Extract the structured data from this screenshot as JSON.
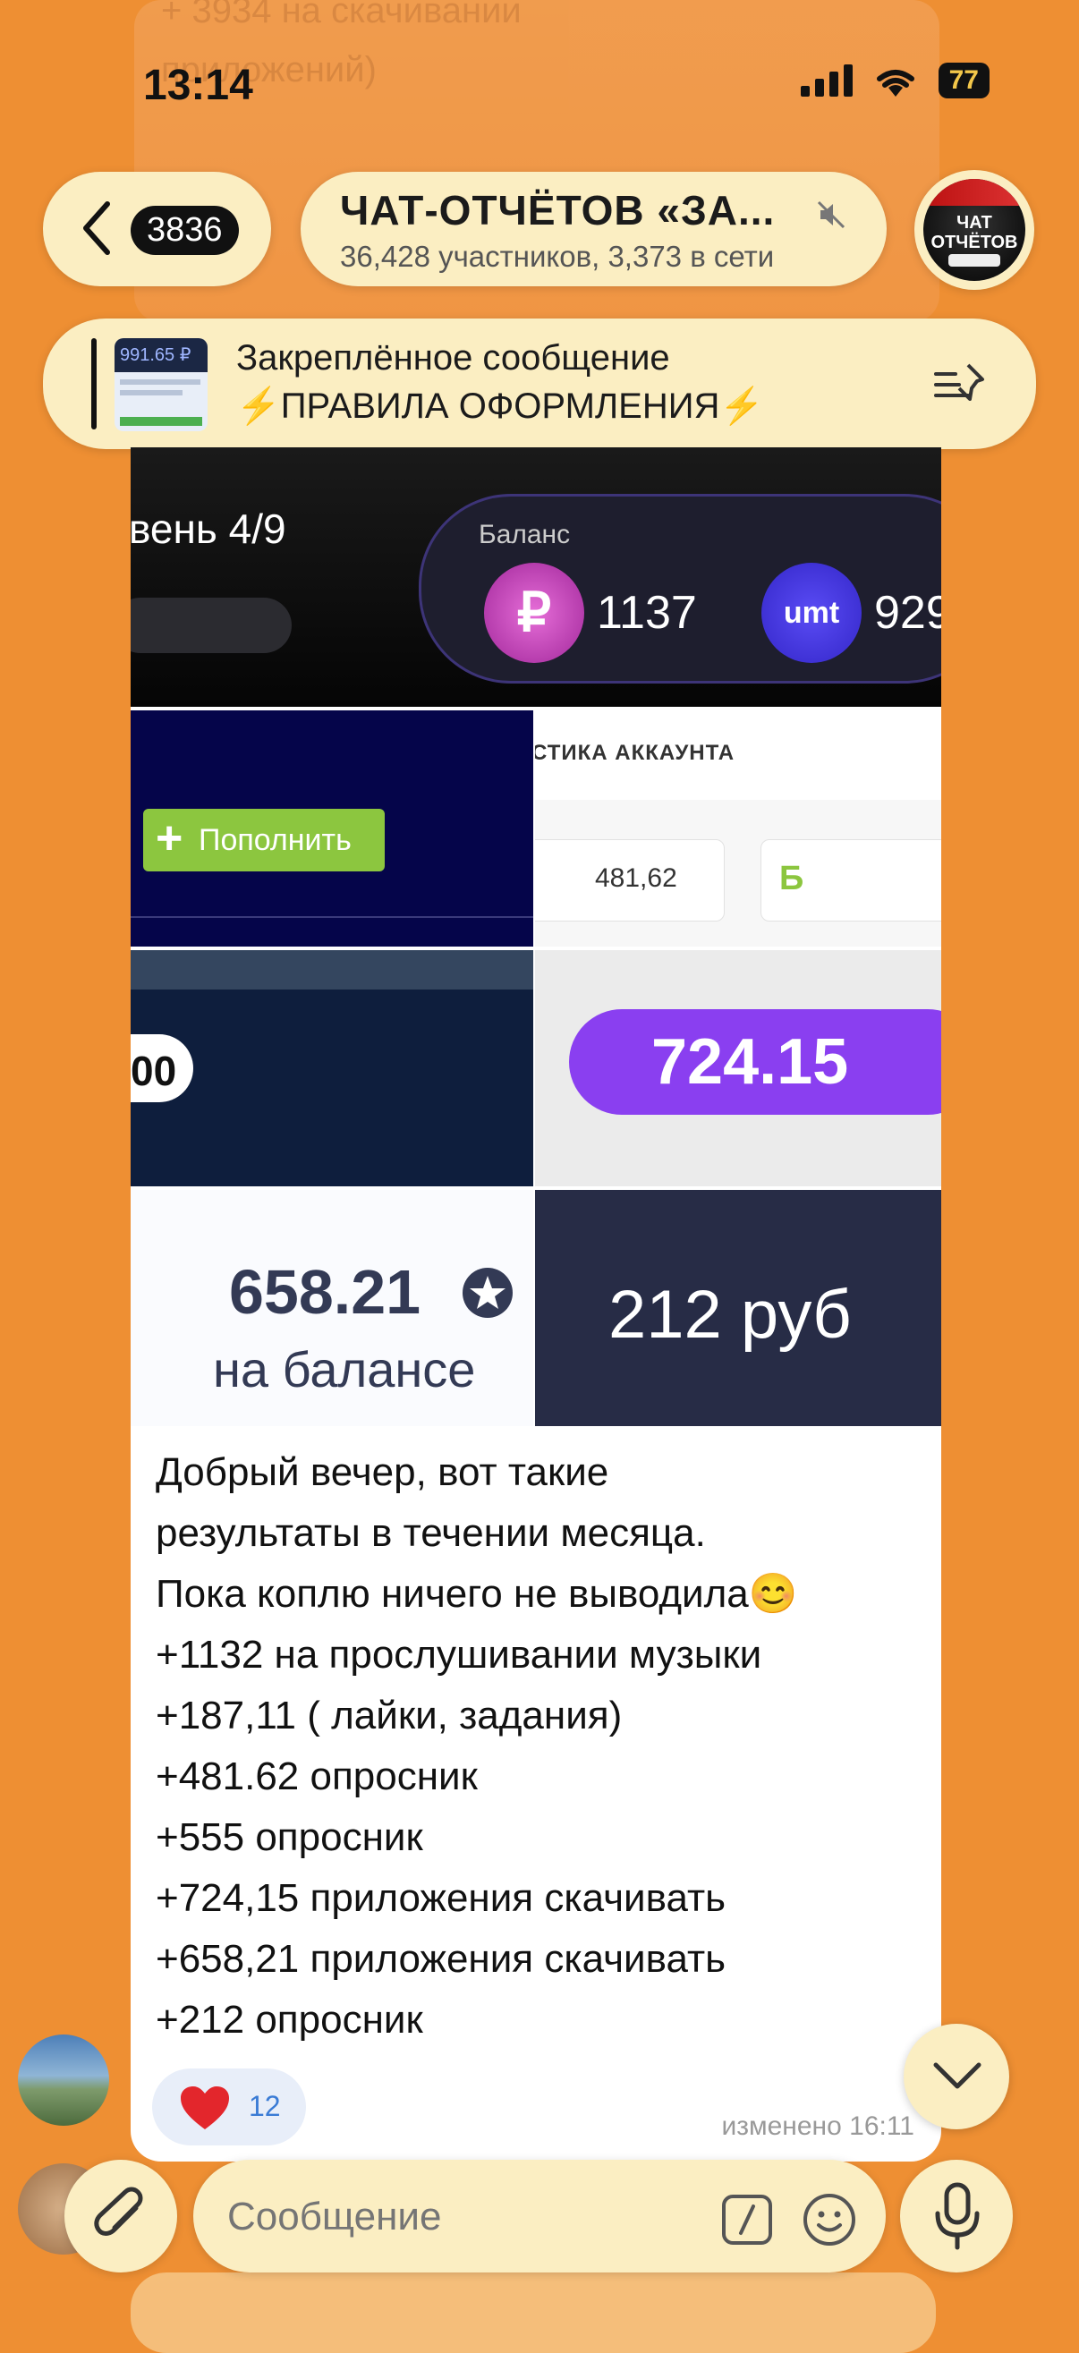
{
  "status": {
    "time": "13:14",
    "battery": "77"
  },
  "background": {
    "ghost_line1": "+ 3934 на скачивании",
    "ghost_line2": "приложений)"
  },
  "header": {
    "unread_count": "3836",
    "title": "ЧАТ-ОТЧЁТОВ «ЗА...",
    "subtitle": "36,428 участников, 3,373 в сети",
    "avatar_text": "ЧАТ ОТЧЁТОВ"
  },
  "pinned": {
    "title": "Закреплённое сообщение",
    "text": "⚡ПРАВИЛА ОФОРМЛЕНИЯ⚡",
    "thumb_value": "991.65 ₽"
  },
  "tiles": {
    "t1": {
      "level": "вень 4/9",
      "balance_label": "Баланс",
      "rub_value": "1137",
      "umt_label": "umt",
      "umt_value": "929"
    },
    "t2": {
      "button": "Пополнить"
    },
    "t3": {
      "header": "СТИКА АККАУНТА",
      "value": "481,62",
      "currency": "Б"
    },
    "t4": {
      "value": "00"
    },
    "t5": {
      "value": "724.15"
    },
    "t6": {
      "value": "658.21",
      "caption": "на балансе"
    },
    "t7": {
      "value": "212 руб"
    }
  },
  "message": {
    "lines": [
      "Добрый вечер, вот такие",
      "результаты в течении месяца.",
      "Пока коплю ничего не выводила😊",
      "+1132 на прослушивании музыки",
      "+187,11 ( лайки, задания)",
      "+481.62 опросник",
      "+555 опросник",
      "+724,15 приложения скачивать",
      "+658,21 приложения скачивать",
      "+212 опросник"
    ],
    "reaction_emoji": "❤️",
    "reaction_count": "12",
    "edited": "изменено 16:11"
  },
  "input": {
    "placeholder": "Сообщение"
  },
  "colors": {
    "background": "#ee8f33",
    "pill": "#fbeec2",
    "accent_purple": "#8a3ff0",
    "accent_green": "#8cc63f"
  }
}
